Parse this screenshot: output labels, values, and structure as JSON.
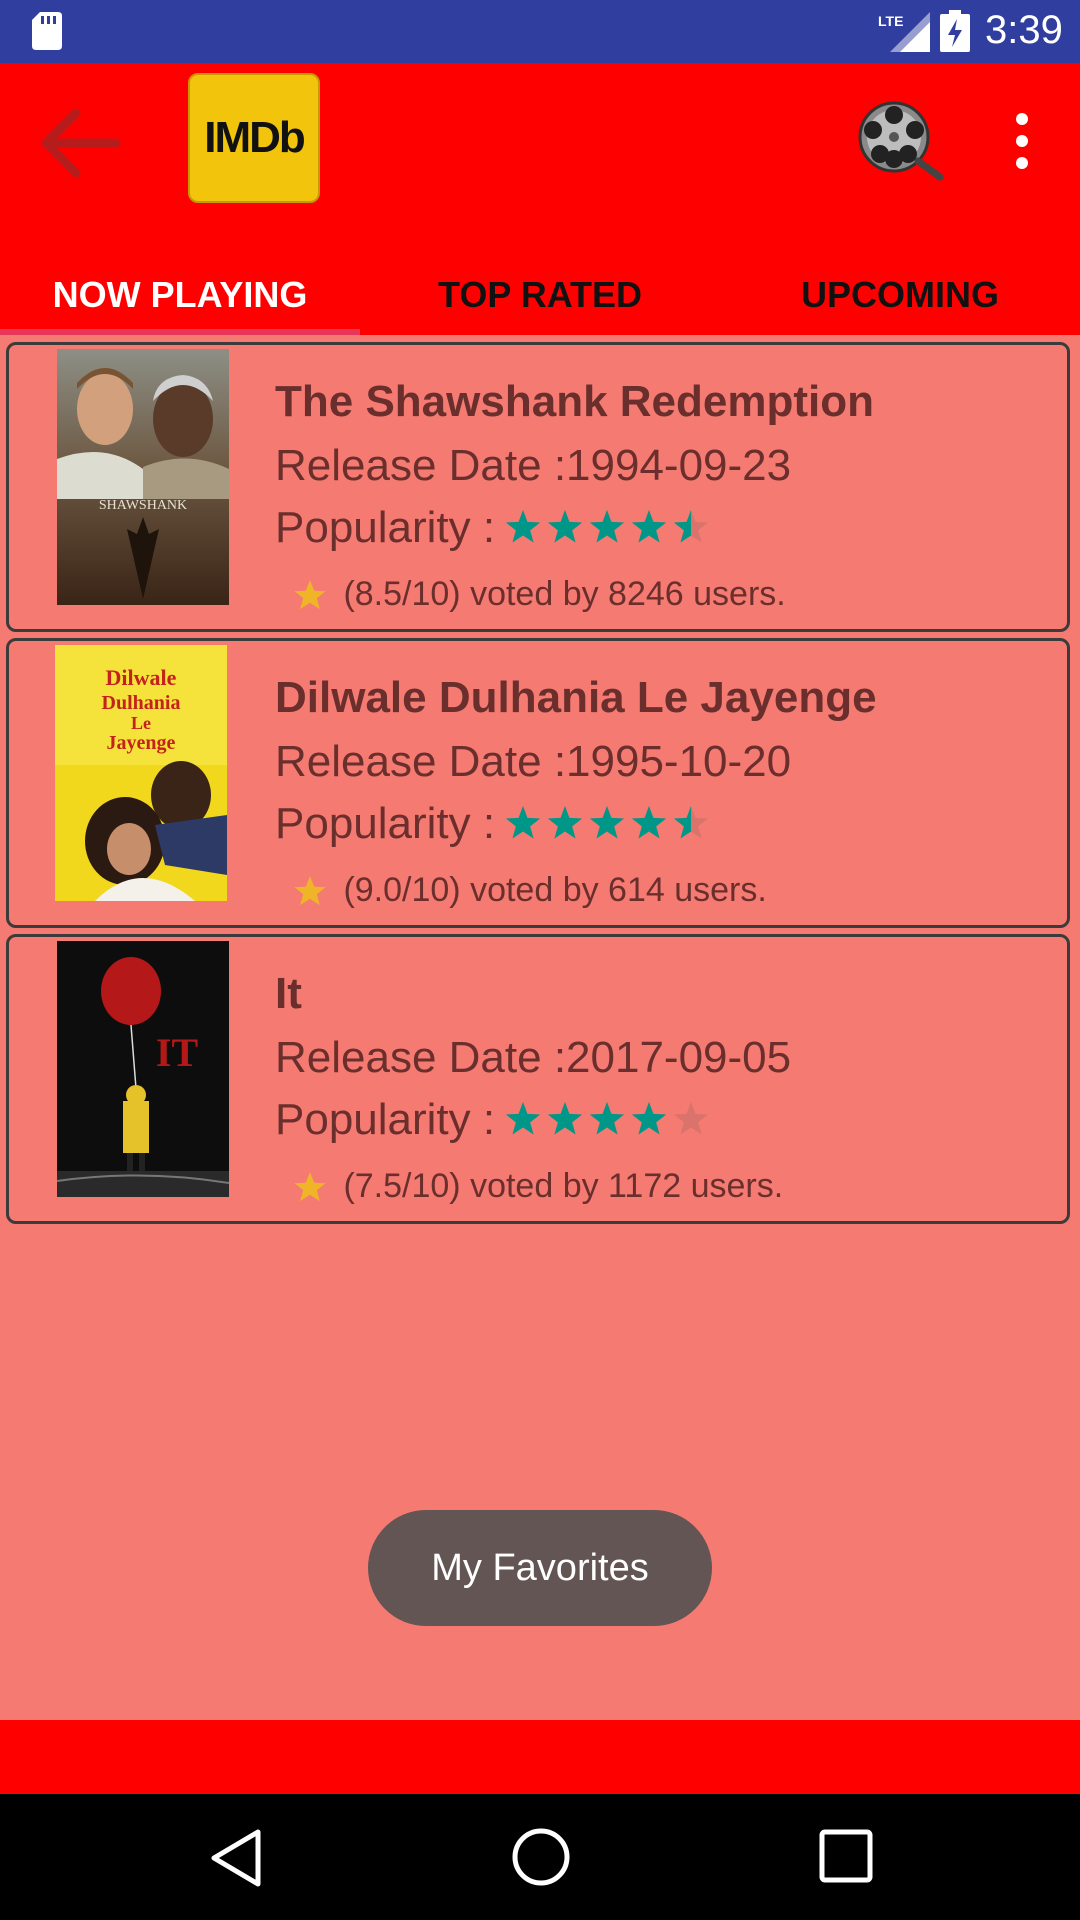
{
  "status_bar": {
    "time": "3:39",
    "network": "LTE"
  },
  "app_bar": {
    "logo_text": "IMDb"
  },
  "tabs": [
    {
      "label": "NOW PLAYING",
      "active": true
    },
    {
      "label": "TOP RATED",
      "active": false
    },
    {
      "label": "UPCOMING",
      "active": false
    }
  ],
  "movies": [
    {
      "title": "The Shawshank Redemption",
      "release": "Release Date :1994-09-23",
      "popularity_label": "Popularity :",
      "stars": 4.5,
      "vote_text": "(8.5/10) voted by 8246 users.",
      "poster_text": "SHAWSHANK"
    },
    {
      "title": "Dilwale Dulhania Le Jayenge",
      "release": "Release Date :1995-10-20",
      "popularity_label": "Popularity :",
      "stars": 4.5,
      "vote_text": "(9.0/10) voted by 614 users.",
      "poster_text": "Dilwale Dulhania Le Jayenge"
    },
    {
      "title": "It",
      "release": "Release Date :2017-09-05",
      "popularity_label": "Popularity :",
      "stars": 4,
      "vote_text": "(7.5/10) voted by 1172 users.",
      "poster_text": "IT"
    }
  ],
  "fab": {
    "label": "My Favorites"
  },
  "colors": {
    "app_bar": "#ff0000",
    "background": "#f47a72",
    "star": "#009688",
    "vote_star": "#f0b429",
    "tab_indicator": "#e8365a"
  }
}
